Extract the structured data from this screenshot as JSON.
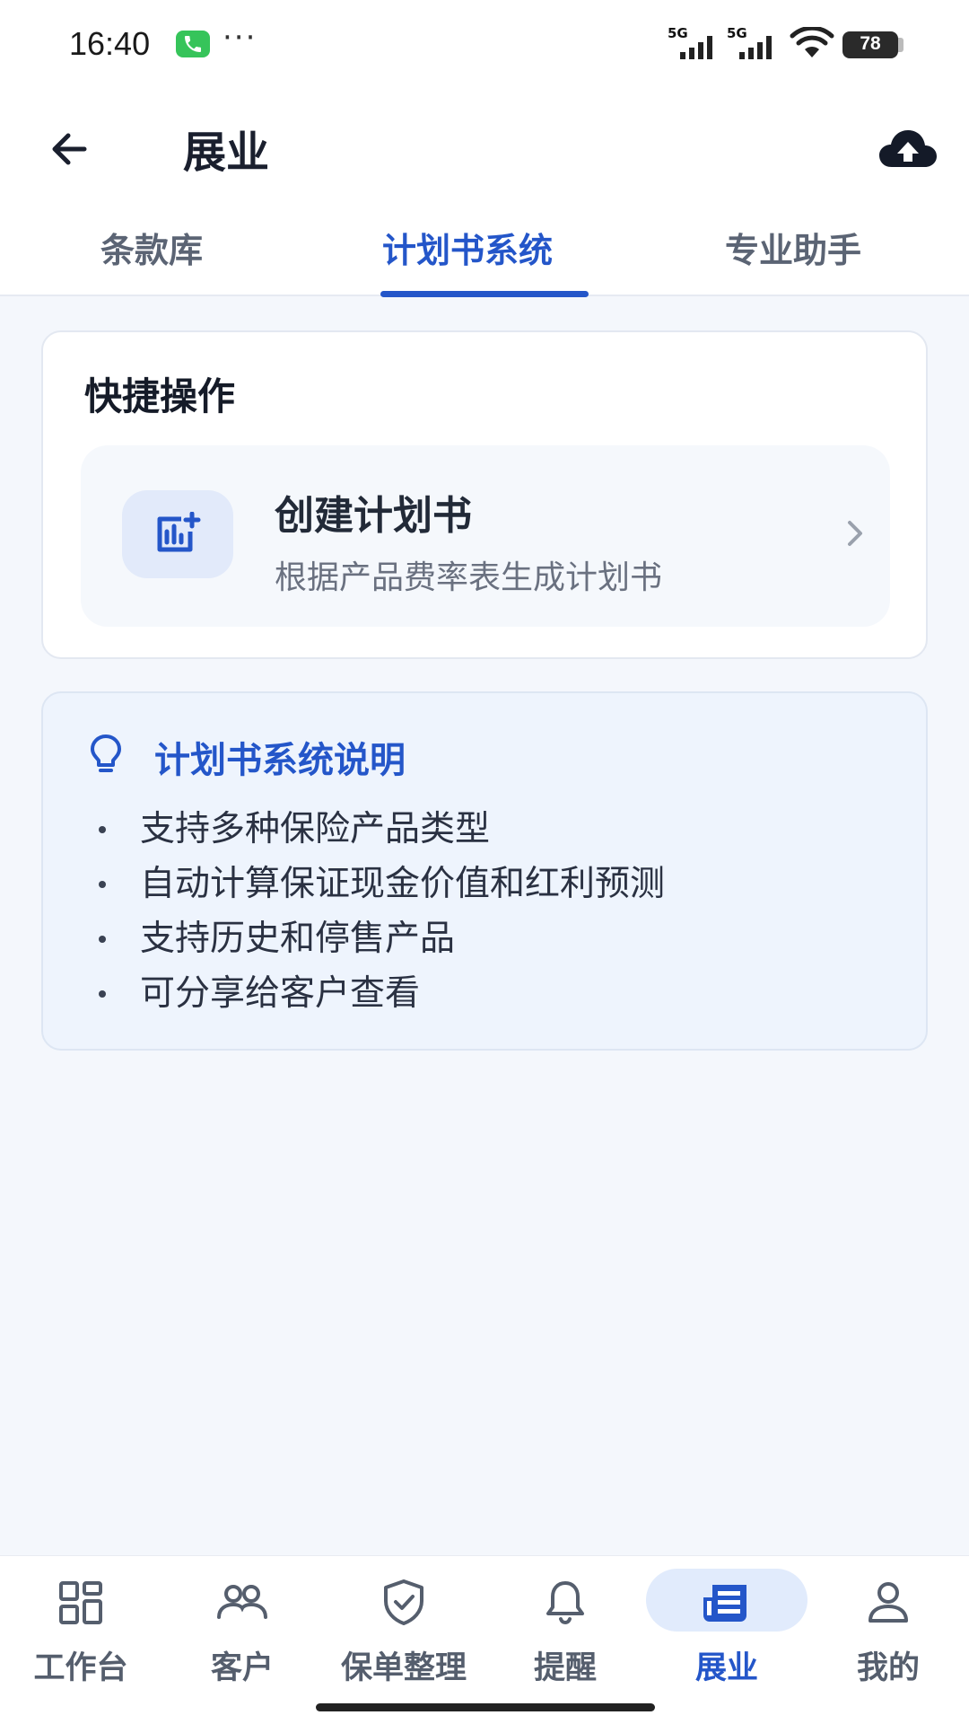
{
  "status_bar": {
    "time": "16:40",
    "dots": "···",
    "network_1": "5G",
    "network_2": "5G",
    "battery": "78"
  },
  "header": {
    "title": "展业",
    "back_icon": "arrow-left-icon",
    "upload_icon": "cloud-upload-icon"
  },
  "tabs": [
    {
      "label": "条款库",
      "active": false
    },
    {
      "label": "计划书系统",
      "active": true
    },
    {
      "label": "专业助手",
      "active": false
    }
  ],
  "quick_actions": {
    "title": "快捷操作",
    "items": [
      {
        "title": "创建计划书",
        "subtitle": "根据产品费率表生成计划书",
        "icon": "add-chart-icon"
      }
    ]
  },
  "info": {
    "title": "计划书系统说明",
    "icon": "lightbulb-icon",
    "items": [
      "支持多种保险产品类型",
      "自动计算保证现金价值和红利预测",
      "支持历史和停售产品",
      "可分享给客户查看"
    ]
  },
  "bottom_nav": [
    {
      "label": "工作台",
      "icon": "dashboard-icon",
      "active": false
    },
    {
      "label": "客户",
      "icon": "users-icon",
      "active": false
    },
    {
      "label": "保单整理",
      "icon": "shield-check-icon",
      "active": false
    },
    {
      "label": "提醒",
      "icon": "bell-icon",
      "active": false
    },
    {
      "label": "展业",
      "icon": "newspaper-icon",
      "active": true
    },
    {
      "label": "我的",
      "icon": "person-icon",
      "active": false
    }
  ],
  "colors": {
    "accent": "#2456c9",
    "background": "#f4f7fc",
    "info_background": "#eef4fd"
  }
}
